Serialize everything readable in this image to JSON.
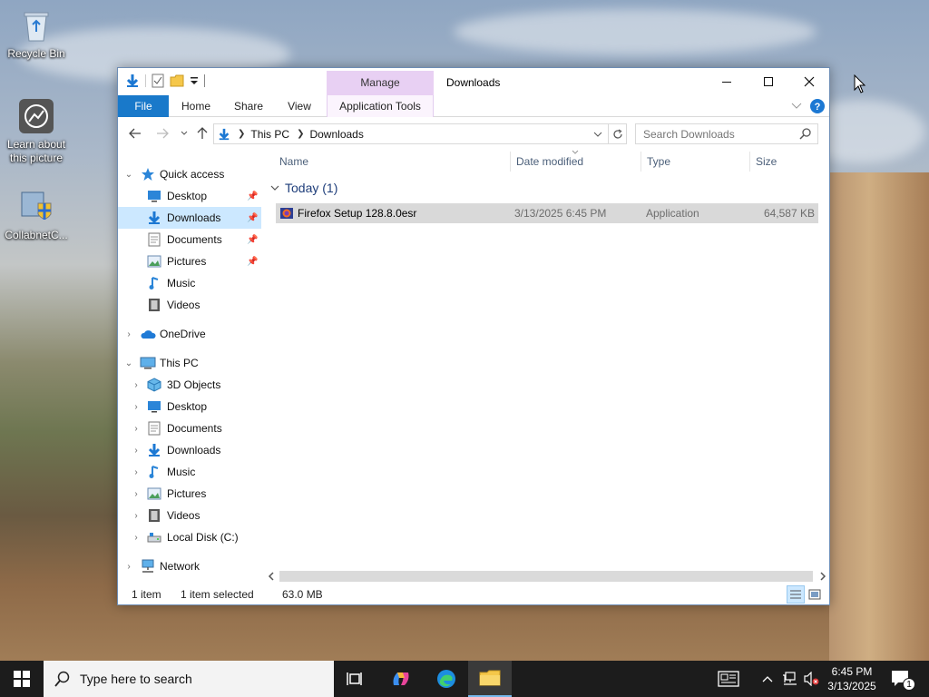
{
  "desktop": {
    "icons": [
      {
        "label": "Recycle Bin"
      },
      {
        "label": "Learn about this picture"
      },
      {
        "label": "CollabnetC..."
      }
    ]
  },
  "window": {
    "title": "Downloads",
    "contextual_group": "Manage",
    "tabs": [
      "File",
      "Home",
      "Share",
      "View",
      "Application Tools"
    ],
    "colors": {
      "file_tab": "#1979ca",
      "selection": "#cce8ff",
      "manage_tab": "#e8d0f3"
    }
  },
  "address": {
    "crumbs": [
      "This PC",
      "Downloads"
    ],
    "search_placeholder": "Search Downloads"
  },
  "nav": {
    "quick_access": "Quick access",
    "quick_items": [
      "Desktop",
      "Downloads",
      "Documents",
      "Pictures",
      "Music",
      "Videos"
    ],
    "onedrive": "OneDrive",
    "this_pc": "This PC",
    "pc_items": [
      "3D Objects",
      "Desktop",
      "Documents",
      "Downloads",
      "Music",
      "Pictures",
      "Videos",
      "Local Disk (C:)"
    ],
    "network": "Network"
  },
  "content": {
    "columns": [
      "Name",
      "Date modified",
      "Type",
      "Size"
    ],
    "group": "Today (1)",
    "files": [
      {
        "name": "Firefox Setup 128.8.0esr",
        "date": "3/13/2025 6:45 PM",
        "type": "Application",
        "size": "64,587 KB"
      }
    ]
  },
  "status": {
    "count": "1 item",
    "selected": "1 item selected",
    "size": "63.0 MB"
  },
  "taskbar": {
    "search_placeholder": "Type here to search",
    "time": "6:45 PM",
    "date": "3/13/2025",
    "notifications": "1"
  }
}
